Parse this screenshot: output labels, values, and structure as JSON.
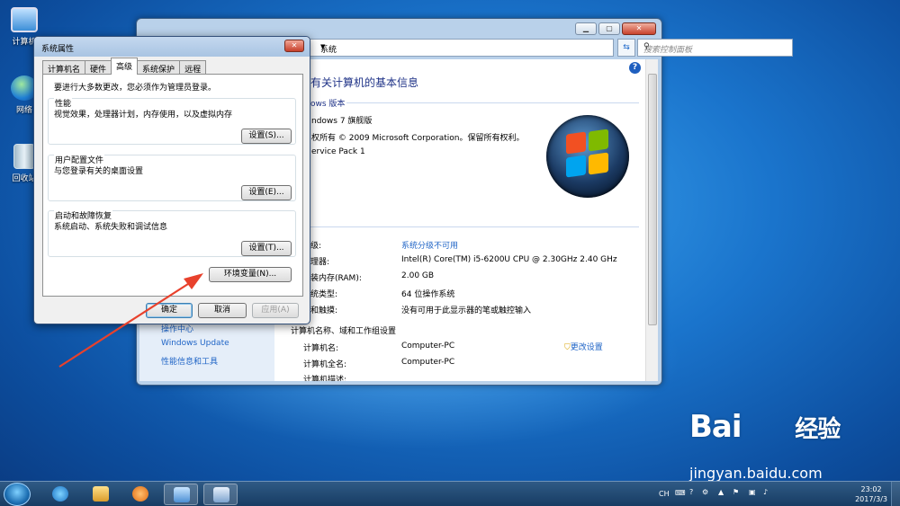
{
  "desktop": {
    "icons": [
      {
        "label": "计算机",
        "icon": "computer-icon"
      },
      {
        "label": "网络",
        "icon": "network-icon"
      },
      {
        "label": "回收站",
        "icon": "recycle-bin-icon"
      }
    ]
  },
  "system_window": {
    "address": "系统",
    "search_placeholder": "搜索控制面板",
    "heading": "有关计算机的基本信息",
    "section_edition": "ows 版本",
    "edition_name": "ndows 7 旗舰版",
    "copyright": "权所有 © 2009 Microsoft Corporation。保留所有权利。",
    "service_pack": "ervice Pack 1",
    "system_section": {
      "rows": [
        {
          "label": "级:",
          "value": "系统分级不可用",
          "link": true
        },
        {
          "label": "理器:",
          "value": "Intel(R) Core(TM) i5-6200U CPU @ 2.30GHz   2.40 GHz"
        },
        {
          "label": "装内存(RAM):",
          "value": "2.00 GB"
        },
        {
          "label": "统类型:",
          "value": "64 位操作系统"
        },
        {
          "label": "和触摸:",
          "value": "没有可用于此显示器的笔或触控输入"
        }
      ]
    },
    "computer_section": {
      "title": "计算机名称、域和工作组设置",
      "change_settings": "更改设置",
      "rows": [
        {
          "label": "计算机名:",
          "value": "Computer-PC"
        },
        {
          "label": "计算机全名:",
          "value": "Computer-PC"
        },
        {
          "label": "计算机描述:",
          "value": ""
        }
      ]
    },
    "left_links": [
      "操作中心",
      "Windows Update",
      "性能信息和工具"
    ]
  },
  "dialog": {
    "title": "系统属性",
    "tabs": [
      "计算机名",
      "硬件",
      "高级",
      "系统保护",
      "远程"
    ],
    "active_tab": "高级",
    "admin_note": "要进行大多数更改，您必须作为管理员登录。",
    "groups": [
      {
        "title": "性能",
        "desc": "视觉效果，处理器计划，内存使用，以及虚拟内存",
        "button": "设置(S)..."
      },
      {
        "title": "用户配置文件",
        "desc": "与您登录有关的桌面设置",
        "button": "设置(E)..."
      },
      {
        "title": "启动和故障恢复",
        "desc": "系统启动、系统失败和调试信息",
        "button": "设置(T)..."
      }
    ],
    "env_button": "环境变量(N)...",
    "ok": "确定",
    "cancel": "取消",
    "apply": "应用(A)"
  },
  "taskbar": {
    "lang": "CH",
    "time": "23:02",
    "date": "2017/3/3"
  },
  "watermark": {
    "brand": "Bai",
    "brand2": "经验",
    "url": "jingyan.baidu.com"
  },
  "colors": {
    "accent": "#1e3287",
    "link": "#1f64c6",
    "arrow": "#e8412c"
  }
}
